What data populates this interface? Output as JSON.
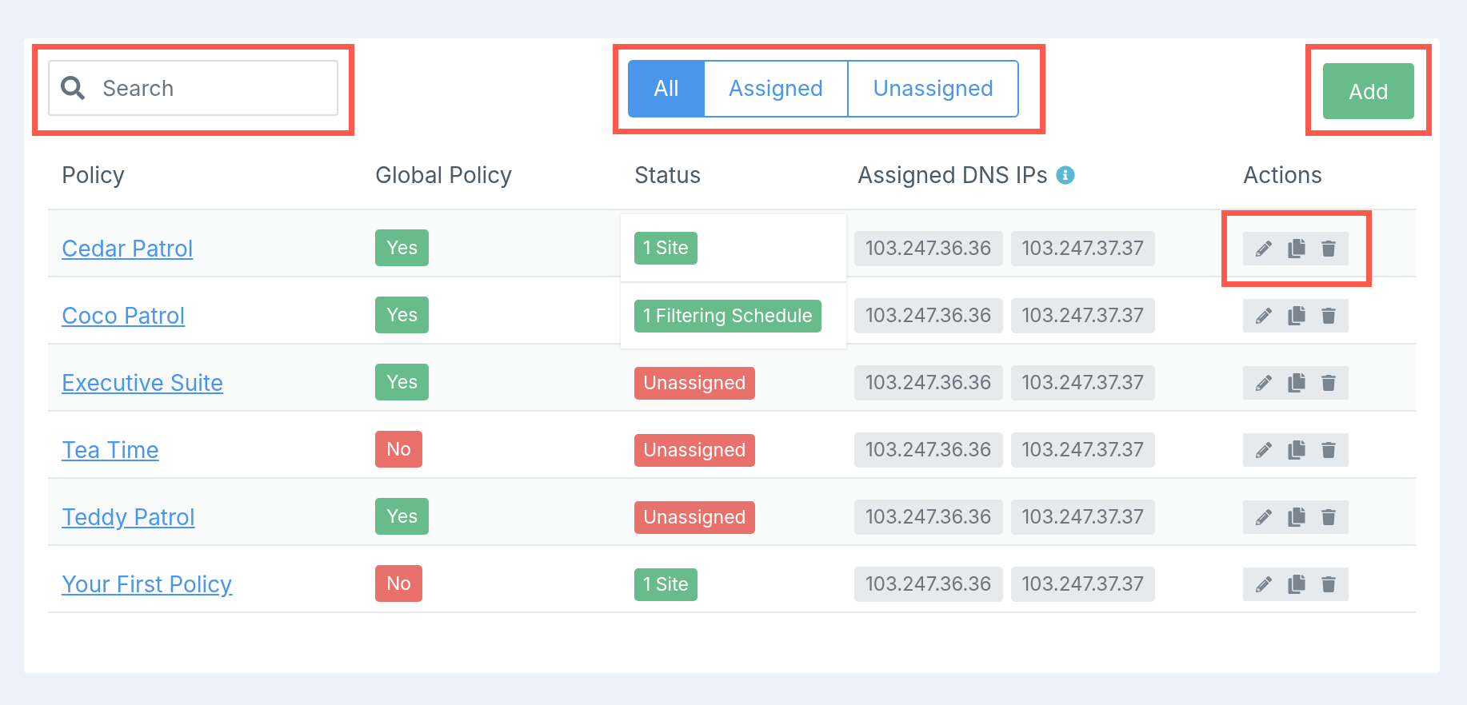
{
  "toolbar": {
    "search": {
      "placeholder": "Search",
      "highlighted": true
    },
    "filters": {
      "highlighted": true,
      "items": [
        {
          "label": "All",
          "selected": true
        },
        {
          "label": "Assigned",
          "selected": false
        },
        {
          "label": "Unassigned",
          "selected": false
        }
      ]
    },
    "add_button": {
      "label": "Add",
      "highlighted": true
    }
  },
  "table": {
    "columns": [
      {
        "label": "Policy",
        "has_info": false
      },
      {
        "label": "Global Policy",
        "has_info": false
      },
      {
        "label": "Status",
        "has_info": false
      },
      {
        "label": "Assigned DNS IPs",
        "has_info": true
      },
      {
        "label": "Actions",
        "has_info": false
      }
    ],
    "rows": [
      {
        "policy": "Cedar Patrol",
        "global": {
          "text": "Yes",
          "enabled": true
        },
        "status_popover": [
          {
            "text": "1 Site"
          },
          {
            "text": "1 Filtering Schedule"
          }
        ],
        "dns": [
          "103.247.36.36",
          "103.247.37.37"
        ],
        "actions_highlighted": true
      },
      {
        "policy": "Coco Patrol",
        "global": {
          "text": "Yes",
          "enabled": true
        },
        "dns": [
          "103.247.36.36",
          "103.247.37.37"
        ],
        "actions_highlighted": false
      },
      {
        "policy": "Executive Suite",
        "global": {
          "text": "Yes",
          "enabled": true
        },
        "status": {
          "text": "Unassigned",
          "assigned": false
        },
        "dns": [
          "103.247.36.36",
          "103.247.37.37"
        ],
        "actions_highlighted": false
      },
      {
        "policy": "Tea Time",
        "global": {
          "text": "No",
          "enabled": false
        },
        "status": {
          "text": "Unassigned",
          "assigned": false
        },
        "dns": [
          "103.247.36.36",
          "103.247.37.37"
        ],
        "actions_highlighted": false
      },
      {
        "policy": "Teddy Patrol",
        "global": {
          "text": "Yes",
          "enabled": true
        },
        "status": {
          "text": "Unassigned",
          "assigned": false
        },
        "dns": [
          "103.247.36.36",
          "103.247.37.37"
        ],
        "actions_highlighted": false
      },
      {
        "policy": "Your First Policy",
        "global": {
          "text": "No",
          "enabled": false
        },
        "status": {
          "text": "1 Site",
          "assigned": true
        },
        "dns": [
          "103.247.36.36",
          "103.247.37.37"
        ],
        "actions_highlighted": false
      }
    ]
  }
}
